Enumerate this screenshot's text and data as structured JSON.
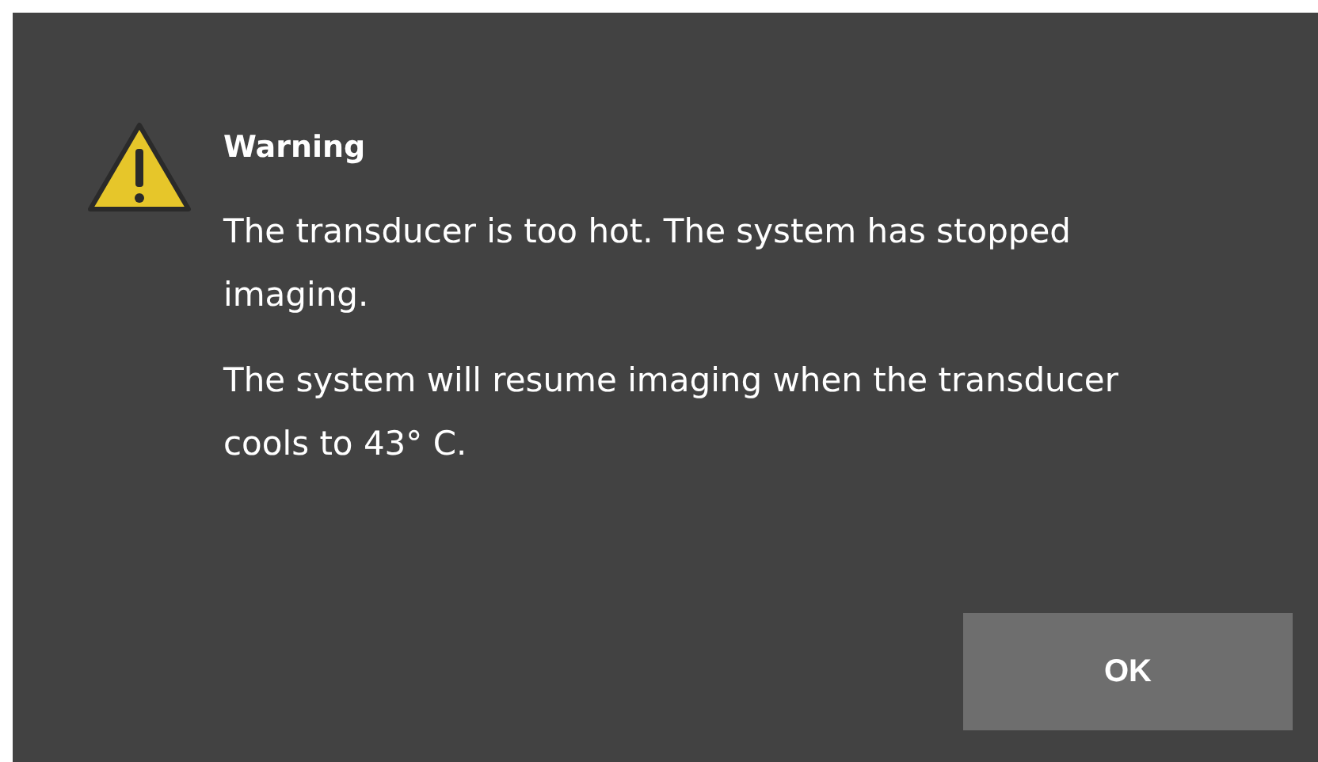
{
  "dialog": {
    "title": "Warning",
    "paragraphs": [
      "The transducer is too hot. The system has stopped imaging.",
      "The system will resume imaging when the transducer cools to 43° C."
    ],
    "buttons": [
      "OK"
    ]
  }
}
